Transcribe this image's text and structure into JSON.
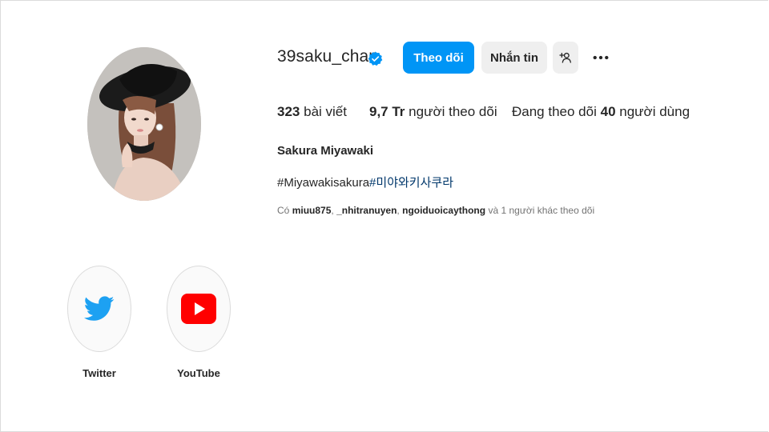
{
  "profile": {
    "username": "39saku_chan",
    "full_name": "Sakura Miyawaki",
    "bio_tag_1": "#Miyawakisakura",
    "bio_tag_2": "#미야와키사쿠라"
  },
  "actions": {
    "follow_label": "Theo dõi",
    "message_label": "Nhắn tin"
  },
  "stats": {
    "posts_count": "323",
    "posts_label": "bài viết",
    "followers_count": "9,7 Tr",
    "followers_label": "người theo dõi",
    "following_prefix": "Đang theo dõi",
    "following_count": "40",
    "following_label": "người dùng"
  },
  "followed_by": {
    "prefix": "Có",
    "user_1": "miuu875",
    "sep_1": ",",
    "user_2": "_nhitranuyen",
    "sep_2": ",",
    "user_3": "ngoiduoicaythong",
    "suffix": "và 1 người khác theo dõi"
  },
  "highlights": [
    {
      "label": "Twitter",
      "icon": "twitter-icon"
    },
    {
      "label": "YouTube",
      "icon": "youtube-icon"
    }
  ],
  "colors": {
    "primary": "#0095f6",
    "secondary_button": "#efefef",
    "verified": "#0095f6",
    "twitter": "#1da1f2",
    "youtube": "#ff0000",
    "hashtag": "#00376b"
  }
}
